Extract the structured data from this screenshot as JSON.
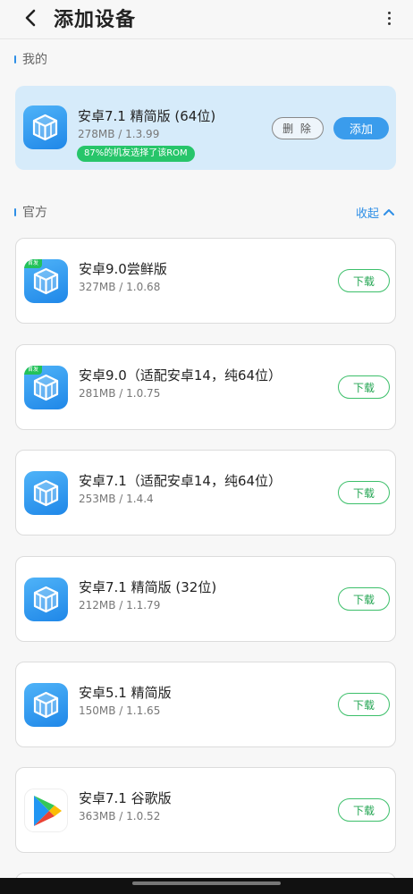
{
  "header": {
    "title": "添加设备",
    "back_icon": "chevron-left-icon",
    "more_icon": "more-vertical-icon"
  },
  "sections": {
    "mine": {
      "title": "我的"
    },
    "official": {
      "title": "官方",
      "collapse_label": "收起"
    }
  },
  "mine_card": {
    "name": "安卓7.1 精简版 (64位)",
    "meta": "278MB / 1.3.99",
    "badge": "87%的机友选择了该ROM",
    "delete_label": "删 除",
    "add_label": "添加",
    "icon": "cube-icon"
  },
  "official_items": [
    {
      "name": "安卓9.0尝鲜版",
      "meta": "327MB / 1.0.68",
      "download_label": "下载",
      "icon": "cube-icon",
      "badge": "首发"
    },
    {
      "name": "安卓9.0（适配安卓14，纯64位）",
      "meta": "281MB / 1.0.75",
      "download_label": "下载",
      "icon": "cube-icon",
      "badge": "首发"
    },
    {
      "name": "安卓7.1（适配安卓14，纯64位）",
      "meta": "253MB / 1.4.4",
      "download_label": "下载",
      "icon": "cube-icon"
    },
    {
      "name": "安卓7.1 精简版 (32位)",
      "meta": "212MB / 1.1.79",
      "download_label": "下载",
      "icon": "cube-icon"
    },
    {
      "name": "安卓5.1 精简版",
      "meta": "150MB / 1.1.65",
      "download_label": "下载",
      "icon": "cube-icon"
    },
    {
      "name": "安卓7.1 谷歌版",
      "meta": "363MB / 1.0.52",
      "download_label": "下载",
      "icon": "google-play-icon"
    }
  ],
  "colors": {
    "accent": "#2f8fe6",
    "download_green": "#3cbf6a",
    "mine_card_bg": "#d6ebfa"
  }
}
